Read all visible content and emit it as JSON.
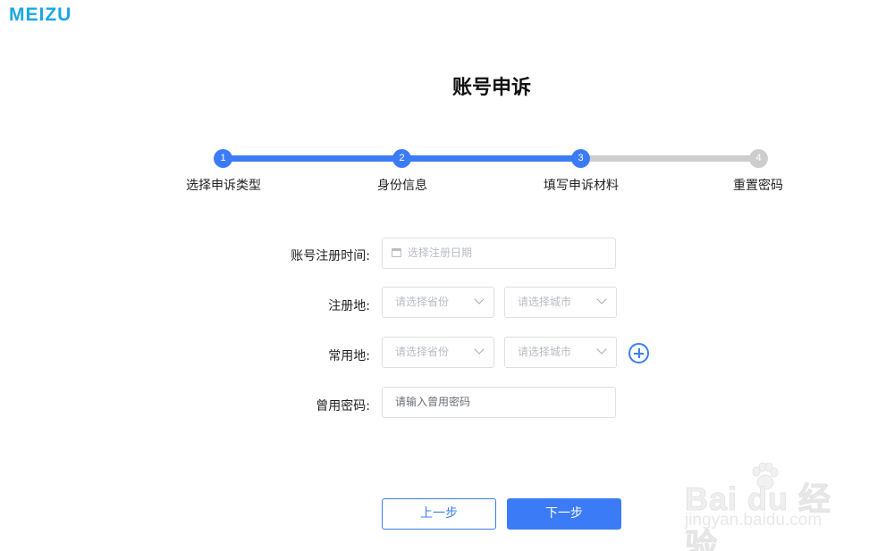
{
  "brand": {
    "logo_text": "MEIZU"
  },
  "page": {
    "title": "账号申诉"
  },
  "stepper": {
    "steps": [
      {
        "number": "1",
        "label": "选择申诉类型"
      },
      {
        "number": "2",
        "label": "身份信息"
      },
      {
        "number": "3",
        "label": "填写申诉材料"
      },
      {
        "number": "4",
        "label": "重置密码"
      }
    ],
    "current_step": 3,
    "active_color": "#3b7cf6",
    "inactive_color": "#cdcdcd"
  },
  "form": {
    "registration_time": {
      "label": "账号注册时间:",
      "placeholder": "选择注册日期",
      "icon": "calendar-icon"
    },
    "registration_place": {
      "label": "注册地:",
      "province_placeholder": "请选择省份",
      "city_placeholder": "请选择城市"
    },
    "frequent_place": {
      "label": "常用地:",
      "province_placeholder": "请选择省份",
      "city_placeholder": "请选择城市",
      "add_icon": "plus-circle-icon"
    },
    "used_password": {
      "label": "曾用密码:",
      "placeholder": "请输入曾用密码"
    }
  },
  "actions": {
    "prev_label": "上一步",
    "next_label": "下一步"
  },
  "watermark": {
    "main_text": "Bai du 经验",
    "sub_text": "jingyan.baidu.com"
  },
  "colors": {
    "accent": "#3b7cf6",
    "logo": "#1aa6e8"
  }
}
